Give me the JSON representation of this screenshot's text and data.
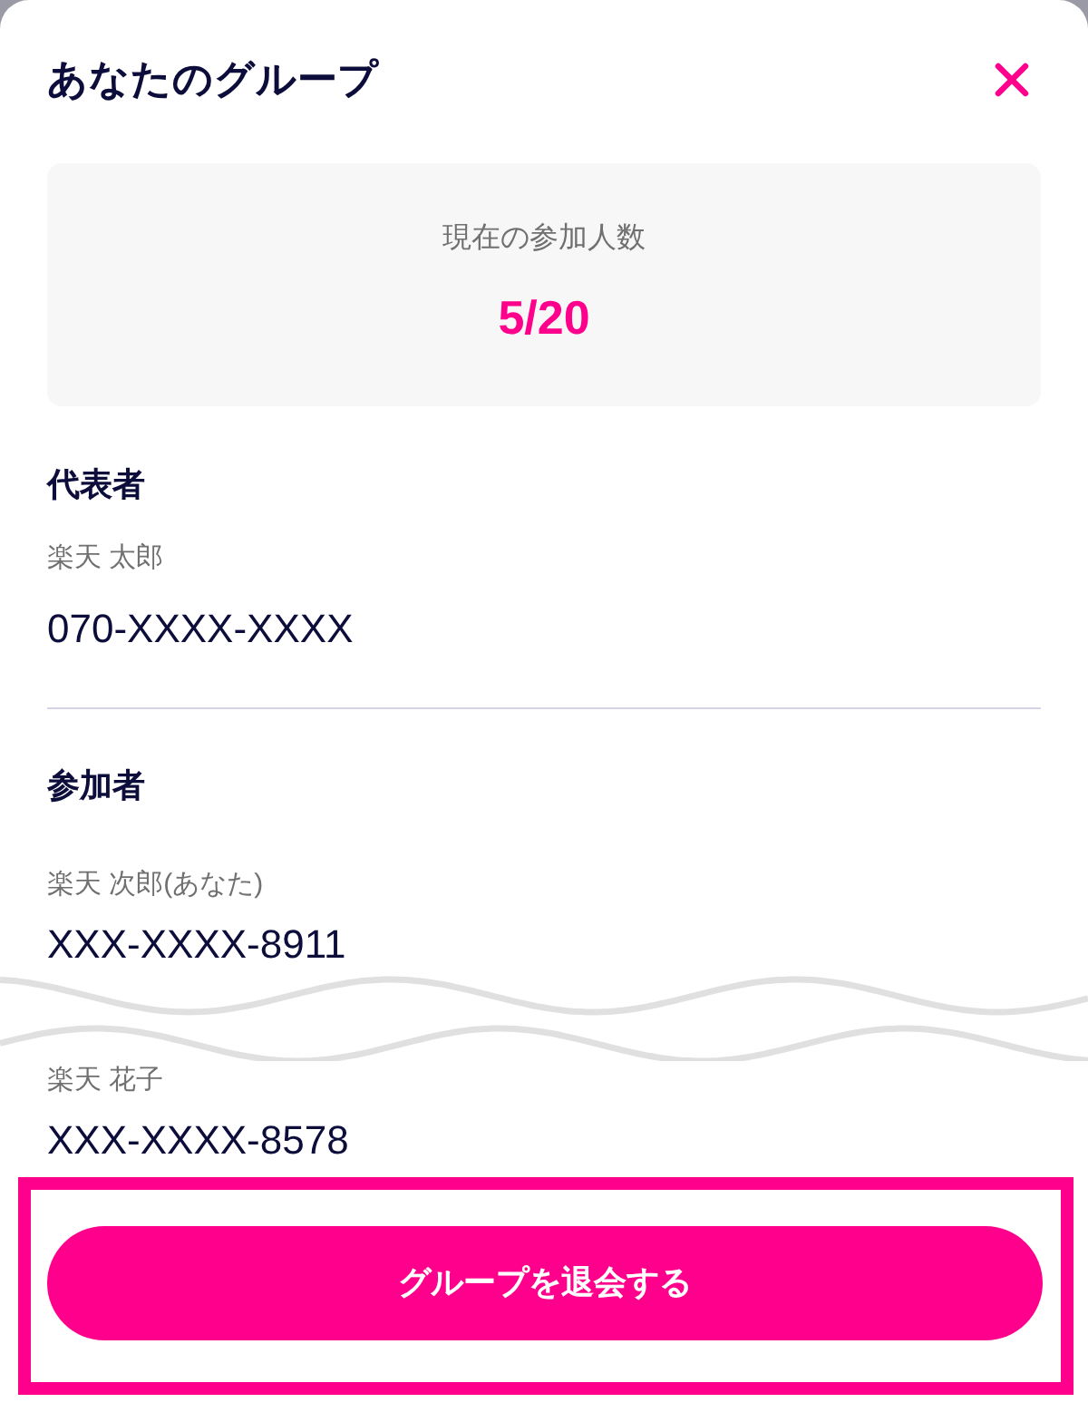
{
  "sheet": {
    "title": "あなたのグループ"
  },
  "count_card": {
    "label": "現在の参加人数",
    "value": "5/20"
  },
  "sections": [
    {
      "heading": "代表者",
      "items": [
        {
          "kind": "member",
          "name": "楽天 太郎",
          "phone": "070-XXXX-XXXX"
        }
      ]
    },
    {
      "heading": "参加者",
      "items": [
        {
          "kind": "member",
          "name": "楽天 次郎(あなた)",
          "phone": "XXX-XXXX-8911"
        },
        {
          "kind": "break"
        },
        {
          "kind": "member",
          "name": "楽天 花子",
          "phone": "XXX-XXXX-8578"
        }
      ]
    }
  ],
  "leave_button": {
    "label": "グループを退会する",
    "highlighted": true
  }
}
